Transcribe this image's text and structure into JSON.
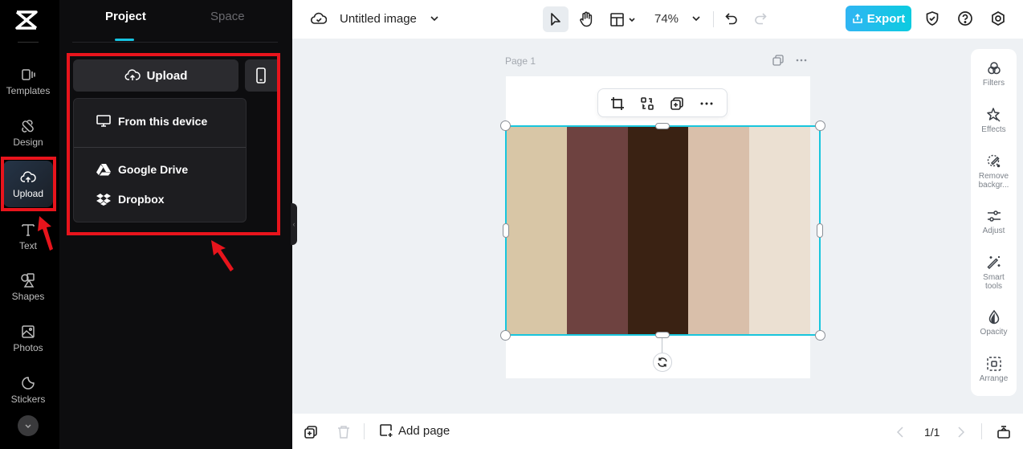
{
  "rail": {
    "items": [
      {
        "label": "Templates",
        "icon": "templates-icon"
      },
      {
        "label": "Design",
        "icon": "design-icon"
      },
      {
        "label": "Upload",
        "icon": "upload-cloud-icon",
        "active": true
      },
      {
        "label": "Text",
        "icon": "text-icon"
      },
      {
        "label": "Shapes",
        "icon": "shapes-icon"
      },
      {
        "label": "Photos",
        "icon": "photos-icon"
      },
      {
        "label": "Stickers",
        "icon": "stickers-icon"
      }
    ]
  },
  "panel": {
    "tabs": [
      {
        "label": "Project",
        "active": true
      },
      {
        "label": "Space",
        "active": false
      }
    ],
    "upload_label": "Upload",
    "dropdown": [
      {
        "label": "From this device",
        "icon": "monitor-icon"
      },
      {
        "label": "Google Drive",
        "icon": "google-drive-icon"
      },
      {
        "label": "Dropbox",
        "icon": "dropbox-icon"
      }
    ]
  },
  "topbar": {
    "title": "Untitled image",
    "zoom": "74%",
    "export_label": "Export"
  },
  "canvas": {
    "page_label": "Page 1",
    "swatches": [
      "#d8c6a6",
      "#6e4240",
      "#3a2213",
      "#d9bfaa",
      "#ebe0d2"
    ]
  },
  "right_tools": [
    {
      "label": "Filters"
    },
    {
      "label": "Effects"
    },
    {
      "label": "Remove backgr..."
    },
    {
      "label": "Adjust"
    },
    {
      "label": "Smart tools"
    },
    {
      "label": "Opacity"
    },
    {
      "label": "Arrange"
    }
  ],
  "bottombar": {
    "add_page_label": "Add page",
    "page_count": "1/1"
  },
  "colors": {
    "accent": "#18c6dd",
    "annotation_red": "#e8141c"
  }
}
